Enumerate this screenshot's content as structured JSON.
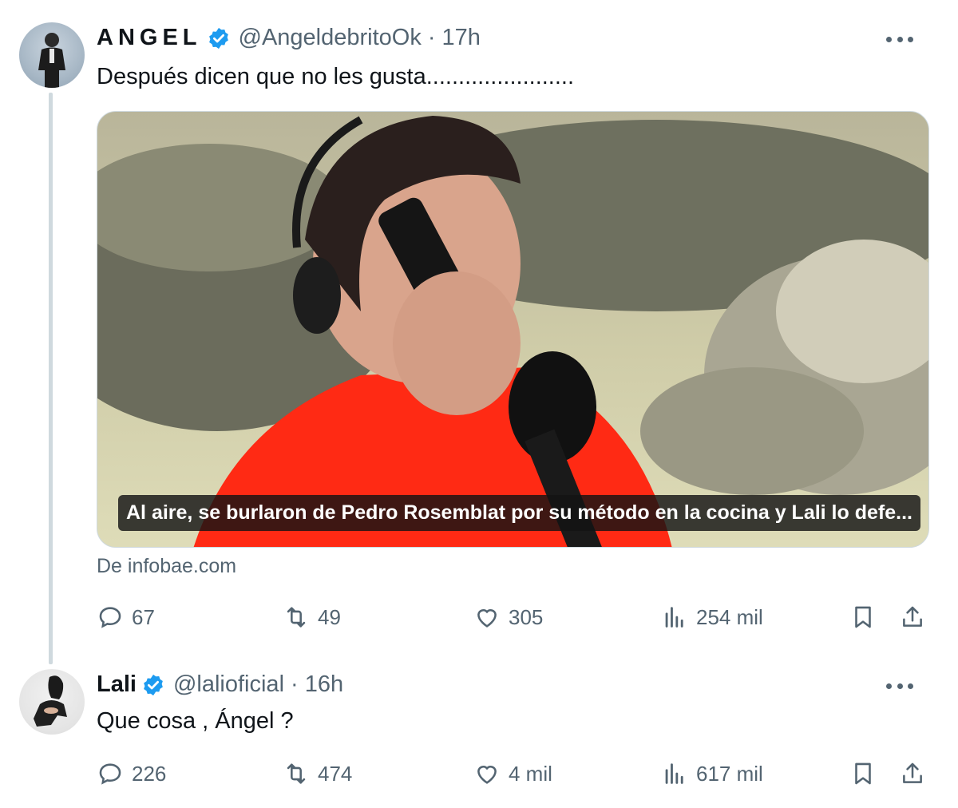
{
  "tweet1": {
    "name": "ANGEL",
    "handle": "@AngeldebritoOk",
    "separator": "·",
    "time": "17h",
    "text": "Después dicen que no les gusta.......................",
    "media_caption": "Al aire, se burlaron de Pedro Rosemblat por su método en la cocina y Lali lo defe...",
    "source": "De infobae.com",
    "stats": {
      "replies": "67",
      "retweets": "49",
      "likes": "305",
      "views": "254 mil"
    }
  },
  "tweet2": {
    "name": "Lali",
    "handle": "@lalioficial",
    "separator": "·",
    "time": "16h",
    "text": "Que cosa , Ángel ?",
    "stats": {
      "replies": "226",
      "retweets": "474",
      "likes": "4 mil",
      "views": "617 mil"
    }
  },
  "icons": {
    "verified": "verified-badge-icon",
    "more": "more-icon",
    "reply": "reply-icon",
    "retweet": "retweet-icon",
    "like": "heart-icon",
    "views": "views-icon",
    "bookmark": "bookmark-icon",
    "share": "share-icon"
  },
  "colors": {
    "verified": "#1d9bf0",
    "muted": "#536471",
    "text": "#0f1419",
    "caption_bg": "#141414",
    "shirt": "#ff2a14"
  }
}
